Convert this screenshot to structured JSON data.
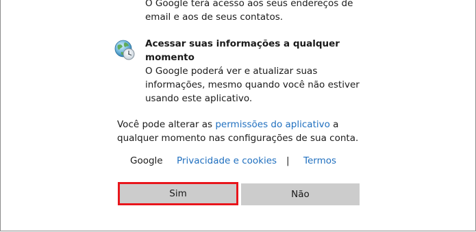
{
  "permissions": {
    "contacts_partial": {
      "description": "O Google terá acesso aos seus endereços de email e aos de seus contatos."
    },
    "offline_access": {
      "title": "Acessar suas informações a qualquer momento",
      "description": "O Google poderá ver e atualizar suas informações, mesmo quando você não estiver usando este aplicativo.",
      "icon": "globe-clock-icon"
    }
  },
  "footer": {
    "text_before": "Você pode alterar as ",
    "link": "permissões do aplicativo",
    "text_after": " a qualquer momento nas configurações de sua conta."
  },
  "links": {
    "google": "Google",
    "privacy": "Privacidade e cookies",
    "separator": "|",
    "terms": "Termos"
  },
  "buttons": {
    "yes": "Sim",
    "no": "Não"
  },
  "colors": {
    "link": "#1f6fbf",
    "button_bg": "#cccccc",
    "focus_border": "#e8151b"
  }
}
